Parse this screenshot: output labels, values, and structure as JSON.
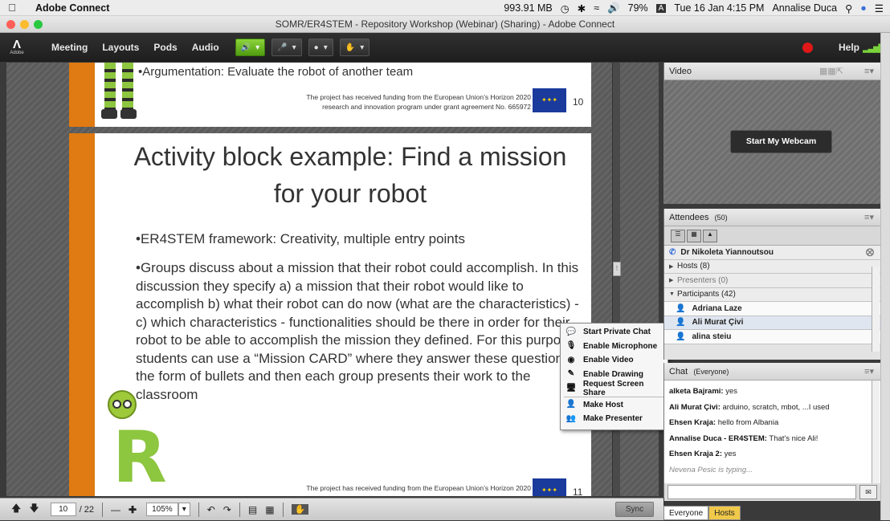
{
  "mac_menubar": {
    "app_name": "Adobe Connect",
    "memory": "993.91 MB",
    "battery": "79%",
    "input_source": "A",
    "datetime": "Tue 16 Jan  4:15 PM",
    "user": "Annalise Duca"
  },
  "window": {
    "title": "SOMR/ER4STEM - Repository Workshop (Webinar) (Sharing) - Adobe Connect"
  },
  "app_menu": {
    "logo_text": "Adobe",
    "items": [
      "Meeting",
      "Layouts",
      "Pods",
      "Audio"
    ],
    "help": "Help"
  },
  "slide_prev": {
    "bullet": "•Argumentation: Evaluate the robot of another team",
    "funding_line1": "The project has received funding from the European Union’s Horizon 2020",
    "funding_line2": "research and innovation program under grant agreement No. 665972",
    "page": "10"
  },
  "slide_current": {
    "title": "Activity block example: Find a mission for your robot",
    "bullet1": "•ER4STEM framework: Creativity, multiple entry points",
    "bullet2": "•Groups discuss about a mission that their robot could accomplish. In this discussion they specify a) a mission that their robot would like to accomplish b) what their robot can do now (what are the characteristics) - c) which characteristics - functionalities should be there in order for their robot to be able to accomplish the mission they defined. For this purpose students can use a “Mission CARD” where they answer these questions in the form of bullets and then each group presents their work to the classroom",
    "funding_line1": "The project has received funding from the European Union’s Horizon 2020",
    "page": "11"
  },
  "context_menu": {
    "items": [
      "Start Private Chat",
      "Enable Microphone",
      "Enable Video",
      "Enable Drawing",
      "Request Screen Share",
      "Make Host",
      "Make Presenter"
    ]
  },
  "bottom_toolbar": {
    "page_current": "10",
    "page_total": "/ 22",
    "zoom": "105%",
    "sync": "Sync"
  },
  "video_pod": {
    "title": "Video",
    "webcam_button": "Start My Webcam"
  },
  "attendees_pod": {
    "title": "Attendees",
    "count": "(50)",
    "current_user": "Dr Nikoleta Yiannoutsou",
    "groups": [
      {
        "label": "Hosts (8)"
      },
      {
        "label": "Presenters (0)"
      },
      {
        "label": "Participants (42)"
      }
    ],
    "participants": [
      "Adriana Laze",
      "Ali Murat Çivi",
      "alina steiu"
    ]
  },
  "chat_pod": {
    "title": "Chat",
    "scope": "(Everyone)",
    "messages": [
      {
        "sender": "alketa Bajrami:",
        "text": " yes"
      },
      {
        "sender": "Ali Murat Çivi:",
        "text": " arduino, scratch, mbot, ...I used"
      },
      {
        "sender": "Ehsen Kraja:",
        "text": " hello from Albania"
      },
      {
        "sender": "Annalise Duca - ER4STEM:",
        "text": " That's nice Ali!"
      },
      {
        "sender": "Ehsen Kraja 2:",
        "text": " yes"
      }
    ],
    "typing": "Nevena Pesic is typing...",
    "tabs": [
      "Everyone",
      "Hosts"
    ]
  },
  "colors": {
    "slide_bar": "#e07a12",
    "eu_blue": "#1a3a9c",
    "audio_green": "#6bb523",
    "record_red": "#e01818"
  }
}
